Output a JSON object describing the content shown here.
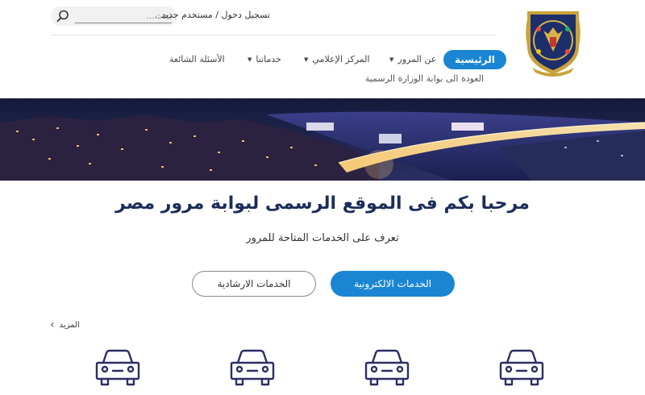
{
  "header": {
    "logo_icon": "ministry-emblem-icon",
    "search": {
      "placeholder": "بحث..."
    },
    "auth": {
      "login": "تسجيل دخول",
      "separator": " / ",
      "register": "مستخدم جديد"
    },
    "nav": {
      "home": "الرئيسية",
      "items": [
        {
          "label": "عن المرور",
          "has_dropdown": true
        },
        {
          "label": "المركز الإعلامي",
          "has_dropdown": true
        },
        {
          "label": "خدماتنا",
          "has_dropdown": true
        },
        {
          "label": "الأسئلة الشائعة",
          "has_dropdown": false
        }
      ],
      "back_link": "العودة الى بوابة الوزارة الرسمية"
    }
  },
  "hero": {
    "title": "مرحبا بكم فى الموقع الرسمى لبوابة مرور مصر",
    "subtitle": "تعرف على الخدمات المتاحة للمرور",
    "buttons": {
      "electronic": "الخدمات الالكترونية",
      "guidance": "الخدمات الارشادية"
    }
  },
  "services": {
    "more_label": "المزيد",
    "icons": [
      "car-icon",
      "car-icon",
      "car-icon",
      "car-icon"
    ]
  },
  "colors": {
    "accent": "#1a86d3",
    "title": "#1c2d5a",
    "banner_dark": "#1c2246"
  }
}
